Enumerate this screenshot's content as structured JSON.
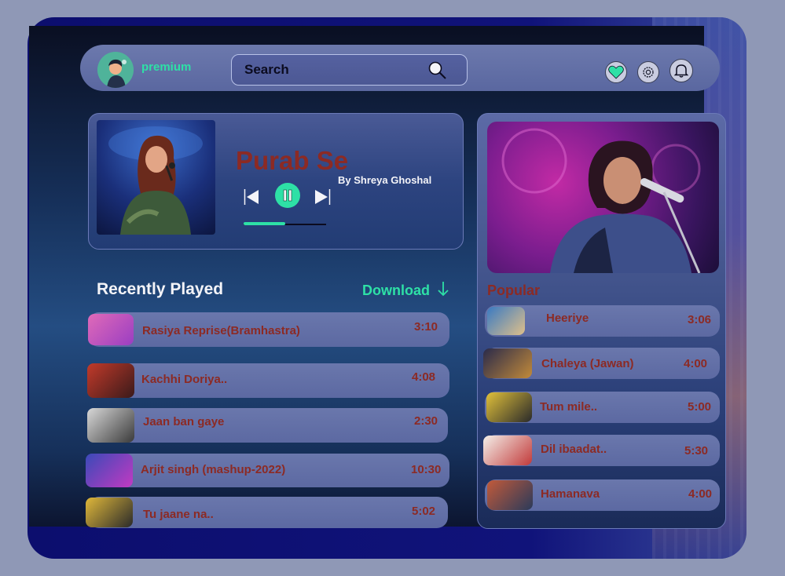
{
  "app": {
    "brand": "premium"
  },
  "search": {
    "placeholder": "Search"
  },
  "now_playing": {
    "title": "Purab Se",
    "artist": "By Shreya Ghoshal",
    "progress": 0.5
  },
  "recently_played": {
    "title": "Recently Played",
    "download_label": "Download",
    "items": [
      {
        "label": "Rasiya Reprise(Bramhastra)",
        "time": "3:10"
      },
      {
        "label": "Kachhi Doriya..",
        "time": "4:08"
      },
      {
        "label": "Jaan ban gaye",
        "time": "2:30"
      },
      {
        "label": "Arjit singh (mashup-2022)",
        "time": "10:30"
      },
      {
        "label": "Tu jaane na..",
        "time": "5:02"
      }
    ]
  },
  "popular": {
    "title": "Popular",
    "items": [
      {
        "label": "Heeriye",
        "time": "3:06"
      },
      {
        "label": "Chaleya (Jawan)",
        "time": "4:00"
      },
      {
        "label": "Tum mile..",
        "time": "5:00"
      },
      {
        "label": "Dil ibaadat..",
        "time": "5:30"
      },
      {
        "label": "Hamanava",
        "time": "4:00"
      }
    ]
  },
  "icons": {
    "heart": "heart-icon",
    "settings": "gear-icon",
    "notifications": "bell-icon",
    "search": "search-icon",
    "previous": "previous-track-icon",
    "pause": "pause-icon",
    "next": "next-track-icon",
    "download": "arrow-down-icon"
  },
  "colors": {
    "accent": "#2ee0a6",
    "song_text": "#8c2a24"
  }
}
